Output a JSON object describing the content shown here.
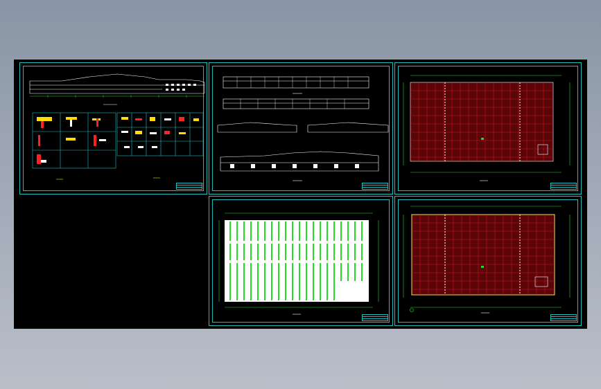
{
  "canvas": {
    "background": "#000000",
    "frame_color": "#1fbfbf"
  },
  "colors": {
    "outline": "#ffffff",
    "grid_red": "#c8141e",
    "fill_red": "#5a0508",
    "dim_green": "#22dd22",
    "detail_yellow": "#ffdd00",
    "detail_red": "#ff2020",
    "plan_border_yellow": "#ffdd44"
  },
  "sheets": [
    {
      "name": "sheet-elevation-details"
    },
    {
      "name": "sheet-elevations"
    },
    {
      "name": "sheet-floor-plan-top"
    },
    {
      "name": "sheet-roof-plan"
    },
    {
      "name": "sheet-floor-plan-bottom"
    }
  ]
}
